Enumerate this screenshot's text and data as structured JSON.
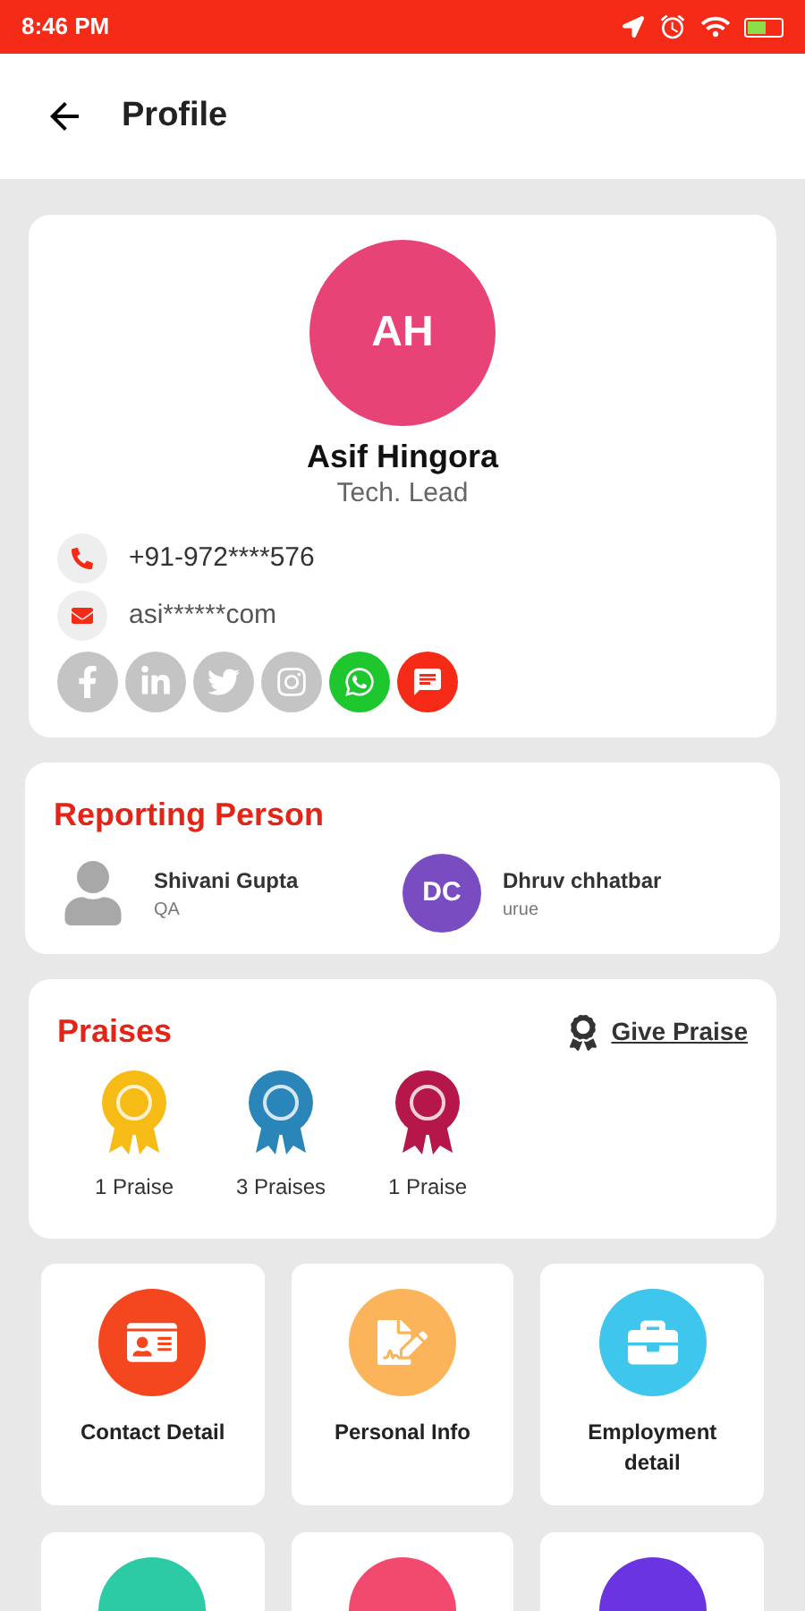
{
  "status_bar": {
    "time": "8:46 PM"
  },
  "header": {
    "title": "Profile"
  },
  "profile": {
    "initials": "AH",
    "name": "Asif Hingora",
    "role": "Tech. Lead",
    "phone": "+91-972****576",
    "email": "asi******com",
    "socials": [
      {
        "kind": "facebook",
        "color": "#c4c4c4"
      },
      {
        "kind": "linkedin",
        "color": "#c4c4c4"
      },
      {
        "kind": "twitter",
        "color": "#c4c4c4"
      },
      {
        "kind": "instagram",
        "color": "#c4c4c4"
      },
      {
        "kind": "whatsapp",
        "color": "#1fc72e"
      },
      {
        "kind": "chat",
        "color": "#f52a17"
      }
    ]
  },
  "reporting": {
    "title": "Reporting Person",
    "people": [
      {
        "kind": "silhouette",
        "name": "Shivani Gupta",
        "role": "QA"
      },
      {
        "kind": "initials",
        "initials": "DC",
        "color": "#7a4cc2",
        "name": "Dhruv chhatbar",
        "role": "urue"
      }
    ]
  },
  "praises": {
    "title": "Praises",
    "action": "Give Praise",
    "badges": [
      {
        "color": "#f7bb16",
        "label": "1 Praise"
      },
      {
        "color": "#2a86b8",
        "label": "3 Praises"
      },
      {
        "color": "#b5174a",
        "label": "1 Praise"
      }
    ]
  },
  "tiles": [
    {
      "kind": "card",
      "color": "#f4471f",
      "label": "Contact Detail"
    },
    {
      "kind": "notes",
      "color": "#fbb45a",
      "label": "Personal Info"
    },
    {
      "kind": "briefcase",
      "color": "#3fc6ec",
      "label": "Employment detail"
    },
    {
      "kind": "partial",
      "color": "#2ccba6"
    },
    {
      "kind": "partial",
      "color": "#f2496e"
    },
    {
      "kind": "partial",
      "color": "#6a35e0"
    }
  ]
}
